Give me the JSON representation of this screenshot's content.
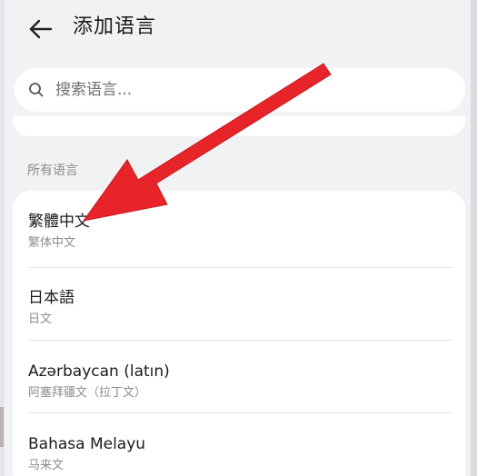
{
  "header": {
    "back_icon": "arrow-left-icon",
    "title": "添加语言"
  },
  "search": {
    "icon": "search-icon",
    "placeholder": "搜索语言..."
  },
  "section": {
    "label": "所有语言"
  },
  "languages": [
    {
      "name": "繁體中文",
      "subtitle": "繁体中文"
    },
    {
      "name": "日本語",
      "subtitle": "日文"
    },
    {
      "name": "Azərbaycan (latın)",
      "subtitle": "阿塞拜疆文（拉丁文）"
    },
    {
      "name": "Bahasa Melayu",
      "subtitle": "马来文"
    }
  ],
  "annotation": {
    "color": "#e8242b",
    "shape": "red-arrow-pointing-to-first-item"
  }
}
